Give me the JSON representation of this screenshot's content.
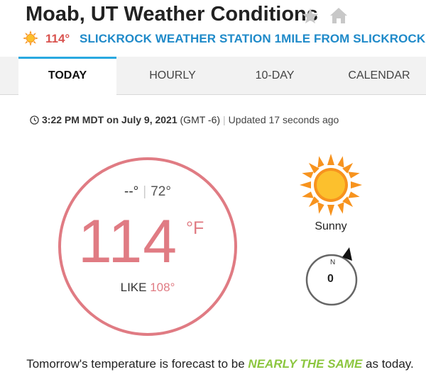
{
  "header": {
    "title": "Moab, UT Weather Conditions",
    "current_temp": "114°",
    "station": "SLICKROCK WEATHER STATION 1MILE FROM SLICKROCK"
  },
  "tabs": [
    {
      "label": "TODAY",
      "active": true
    },
    {
      "label": "HOURLY",
      "active": false
    },
    {
      "label": "10-DAY",
      "active": false
    },
    {
      "label": "CALENDAR",
      "active": false
    }
  ],
  "timestamp": {
    "time": "3:22 PM MDT on July 9, 2021",
    "timezone": "(GMT -6)",
    "separator": "|",
    "updated": "Updated 17 seconds ago"
  },
  "current": {
    "high": "--°",
    "hilo_separator": "|",
    "low": "72°",
    "temperature": "114",
    "unit": "°F",
    "feels_like_label": "LIKE",
    "feels_like_value": "108°",
    "condition": "Sunny",
    "wind_direction_label": "N",
    "wind_speed": "0"
  },
  "forecast": {
    "prefix": "Tomorrow's temperature is forecast to be ",
    "highlight": "NEARLY THE SAME",
    "suffix": " as today."
  },
  "colors": {
    "temp_accent": "#e07b83",
    "station_link": "#1f8ac9",
    "tab_active_border": "#29a8e0",
    "forecast_highlight": "#8cc63f",
    "sun_orange": "#f7931e",
    "sun_yellow": "#fcc02d"
  },
  "icons": {
    "favorite": "star-icon",
    "home": "home-icon",
    "weather": "sun-icon",
    "clock": "clock-icon",
    "wind": "compass-icon"
  }
}
